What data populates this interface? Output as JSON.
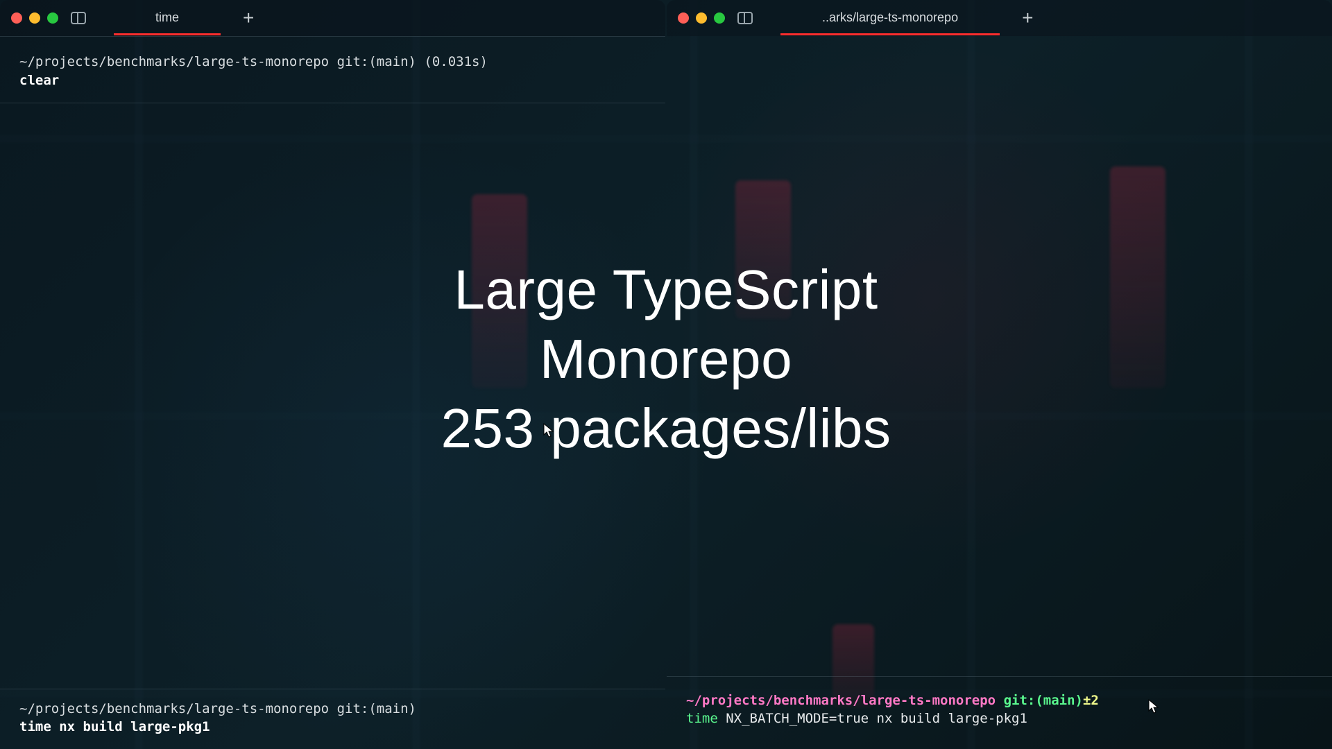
{
  "left_pane": {
    "tab_title": "time",
    "top_prompt": {
      "path": "~/projects/benchmarks/large-ts-monorepo",
      "git_prefix": " git:(",
      "branch": "main",
      "git_suffix": ")",
      "timing": " (0.031s)"
    },
    "top_command": "clear",
    "bottom_prompt": {
      "path": "~/projects/benchmarks/large-ts-monorepo",
      "git_prefix": " git:(",
      "branch": "main",
      "git_suffix": ")"
    },
    "bottom_command": "time nx build large-pkg1"
  },
  "right_pane": {
    "tab_title": "..arks/large-ts-monorepo",
    "bottom_prompt": {
      "path": "~/projects/benchmarks/large-ts-monorepo",
      "git_prefix": " git:(",
      "branch": "main",
      "git_suffix": ")",
      "dirty": "±2"
    },
    "bottom_command_time": "time",
    "bottom_command_rest": " NX_BATCH_MODE=true nx build large-pkg1"
  },
  "overlay": {
    "line1": "Large TypeScript",
    "line2": "Monorepo",
    "line3": "253 packages/libs"
  },
  "icons": {
    "plus": "+"
  }
}
